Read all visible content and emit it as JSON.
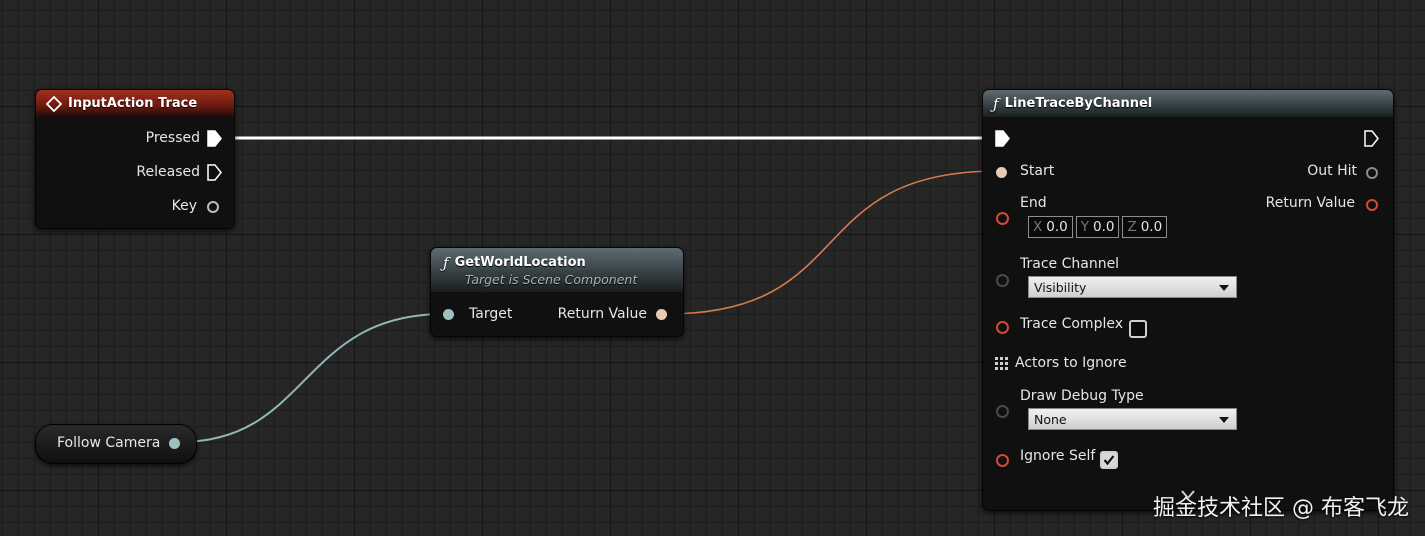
{
  "input_action_node": {
    "title": "InputAction Trace",
    "pins": {
      "pressed": "Pressed",
      "released": "Released",
      "key": "Key"
    }
  },
  "get_world_location_node": {
    "title": "GetWorldLocation",
    "subtitle": "Target is Scene Component",
    "pins": {
      "target": "Target",
      "return_value": "Return Value"
    }
  },
  "follow_camera_node": {
    "label": "Follow Camera"
  },
  "line_trace_node": {
    "title": "LineTraceByChannel",
    "pins": {
      "start": "Start",
      "out_hit": "Out Hit",
      "end": "End",
      "return_value": "Return Value",
      "trace_channel": "Trace Channel",
      "trace_complex": "Trace Complex",
      "actors_to_ignore": "Actors to Ignore",
      "draw_debug_type": "Draw Debug Type",
      "ignore_self": "Ignore Self"
    },
    "end_vector": {
      "x_label": "X",
      "x_value": "0.0",
      "y_label": "Y",
      "y_value": "0.0",
      "z_label": "Z",
      "z_value": "0.0"
    },
    "trace_channel_value": "Visibility",
    "draw_debug_type_value": "None",
    "trace_complex_checked": false,
    "ignore_self_checked": true
  },
  "colors": {
    "vector_pin": "#f0c840",
    "object_pin": "#5fa8e0",
    "bool_pin": "#9b1d1d",
    "exec_wire": "#ffffff",
    "object_wire": "#8fb8b8",
    "vector_wire": "#d67a4e"
  },
  "icons": {
    "event_icon": "diamond-icon",
    "function_icon": "function-f-icon",
    "exec_pin": "exec-arrow-icon",
    "array_pin": "grid-icon",
    "dropdown_arrow": "chevron-down-icon",
    "check": "check-icon"
  },
  "watermark": "掘金技术社区 @ 布客飞龙"
}
